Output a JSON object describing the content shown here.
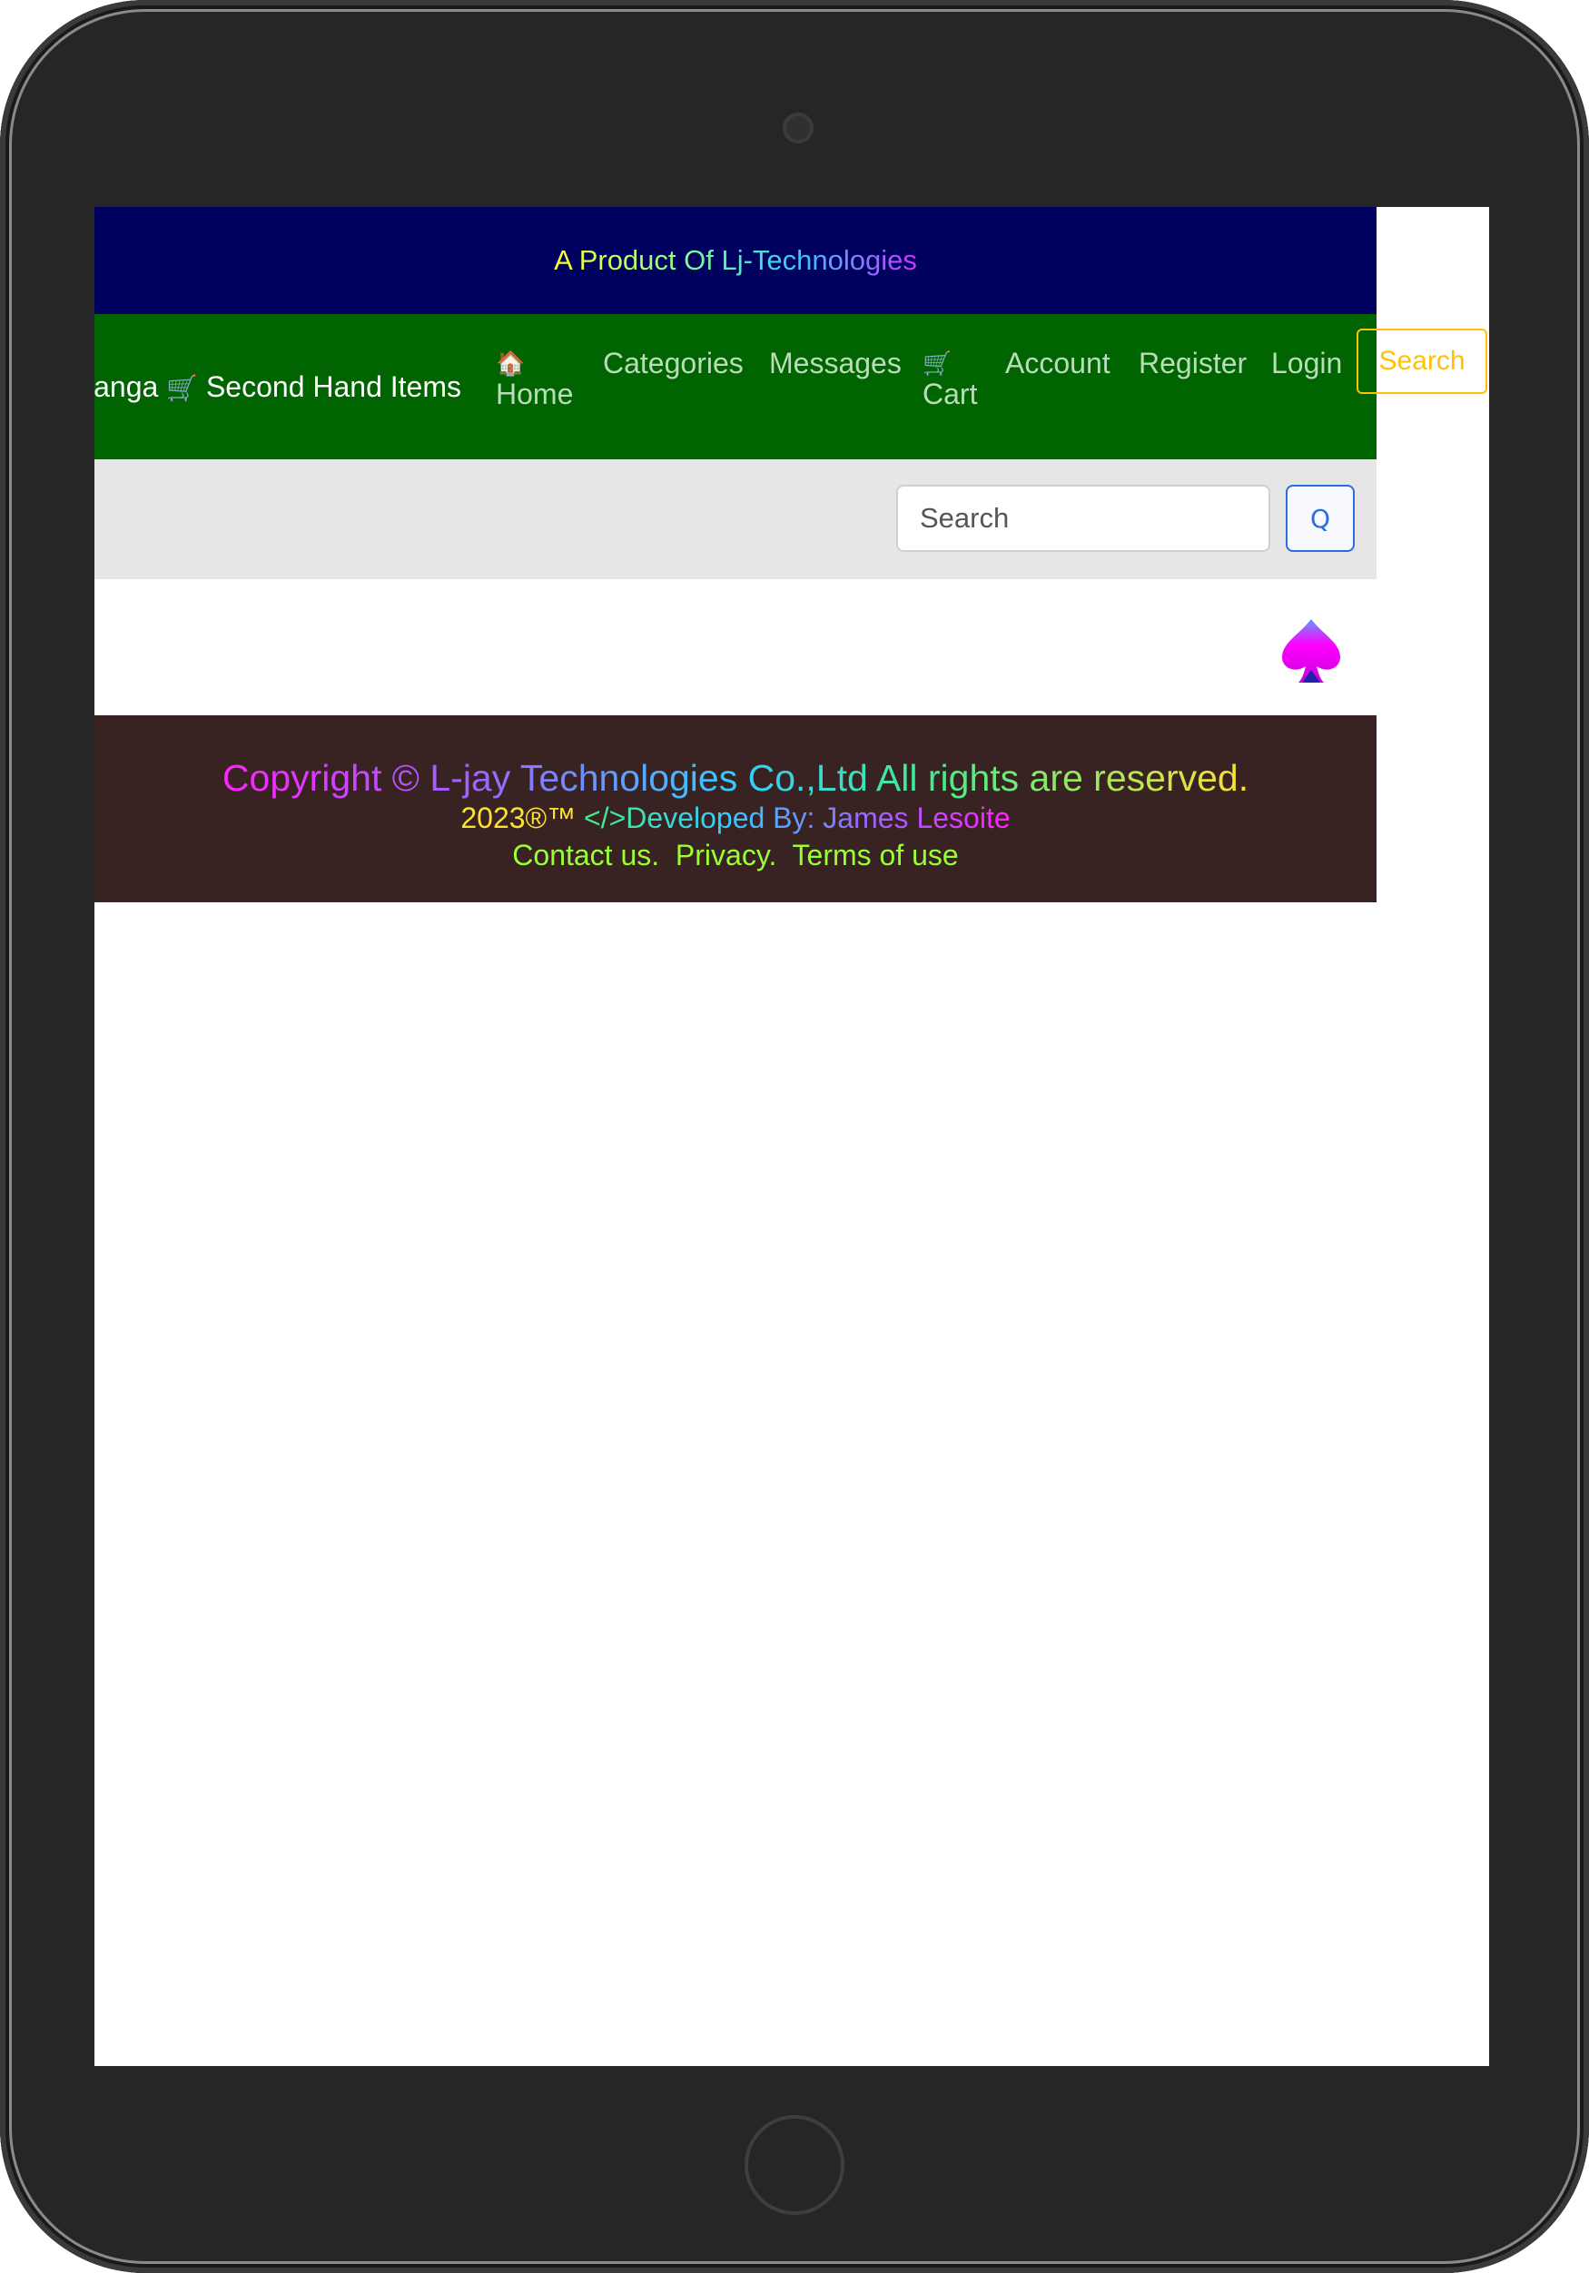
{
  "topbar": {
    "text": "A Product Of Lj-Technologies"
  },
  "navbar": {
    "brand_text": "ianga",
    "brand_icon": "cart-icon",
    "brand_suffix": "Second Hand Items",
    "items": [
      {
        "icon": "house-icon",
        "label": "Home"
      },
      {
        "label": "Categories"
      },
      {
        "label": "Messages"
      },
      {
        "icon": "cart-icon",
        "label": "Cart"
      },
      {
        "label": "Account"
      },
      {
        "label": "Register"
      },
      {
        "label": "Login"
      }
    ],
    "search_button": "Search"
  },
  "searchbar": {
    "placeholder": "Search",
    "button_glyph": "Q"
  },
  "content": {
    "icon": "spade-icon"
  },
  "footer": {
    "copyright": "Copyright © L-jay Technologies Co.,Ltd All rights are reserved.",
    "year": "2023®™",
    "developed": "</>Developed By: James Lesoite",
    "links": [
      "Contact us.",
      "Privacy.",
      "Terms of use"
    ]
  },
  "colors": {
    "topbar_bg": "#00005e",
    "navbar_bg": "#006400",
    "searchbar_bg": "#e6e6e6",
    "footer_bg": "#382222",
    "accent_yellow": "#ffc107",
    "accent_blue": "#2a6dde"
  }
}
